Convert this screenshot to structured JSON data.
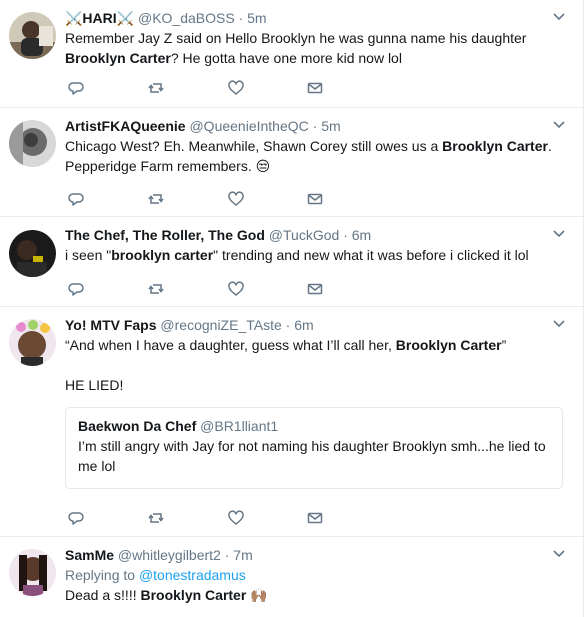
{
  "tweets": [
    {
      "name": "⚔️HARI⚔️",
      "handle": "@KO_daBOSS",
      "sep": "·",
      "time": "5m",
      "lines": [
        {
          "parts": [
            {
              "t": "Remember Jay Z said on Hello Brooklyn he was gunna name his daughter"
            }
          ]
        },
        {
          "parts": [
            {
              "t": "Brooklyn Carter",
              "b": true
            },
            {
              "t": "? He gotta have one more kid now lol"
            }
          ]
        }
      ]
    },
    {
      "name": "ArtistFKAQueenie",
      "handle": "@QueenieIntheQC",
      "sep": "·",
      "time": "5m",
      "lines": [
        {
          "parts": [
            {
              "t": "Chicago West? Eh. Meanwhile, Shawn Corey still owes us a "
            },
            {
              "t": "Brooklyn Carter",
              "b": true
            },
            {
              "t": "."
            }
          ]
        },
        {
          "parts": [
            {
              "t": "Pepperidge Farm remembers. "
            },
            {
              "t": "😒",
              "emoji": true
            }
          ]
        }
      ]
    },
    {
      "name": "The Chef, The Roller, The God",
      "handle": "@TuckGod",
      "sep": "·",
      "time": "6m",
      "lines": [
        {
          "parts": [
            {
              "t": "i seen \""
            },
            {
              "t": "brooklyn carter",
              "b": true
            },
            {
              "t": "\" trending and new what it was before i clicked it lol"
            }
          ]
        }
      ]
    },
    {
      "name": "Yo! MTV Faps",
      "handle": "@recogniZE_TAste",
      "sep": "·",
      "time": "6m",
      "lines": [
        {
          "parts": [
            {
              "t": "“And when I have a daughter, guess what I’ll call her, "
            },
            {
              "t": "Brooklyn Carter",
              "b": true
            },
            {
              "t": "”"
            }
          ]
        },
        {
          "parts": [
            {
              "t": " "
            }
          ]
        },
        {
          "parts": [
            {
              "t": "HE LIED!"
            }
          ]
        }
      ],
      "quote": {
        "name": "Baekwon Da Chef",
        "handle": "@BR1lliant1",
        "lines": [
          "I’m still angry with Jay for not naming his daughter Brooklyn smh...he lied to",
          "me lol"
        ]
      }
    },
    {
      "name": "SamMe",
      "handle": "@whitleygilbert2",
      "sep": "·",
      "time": "7m",
      "replying_label": "Replying to ",
      "replying_handle": "@tonestradamus",
      "lines": [
        {
          "parts": [
            {
              "t": "Dead a  ‌s!!!! "
            },
            {
              "t": "Brooklyn Carter",
              "b": true
            },
            {
              "t": " "
            },
            {
              "t": "🙌🏽",
              "emoji": true
            }
          ]
        }
      ]
    }
  ],
  "icons": {
    "reply": "reply-icon",
    "retweet": "retweet-icon",
    "like": "heart-icon",
    "message": "envelope-icon",
    "caret": "chevron-down-icon"
  },
  "colors": {
    "icon_gray": "#657786",
    "link_blue": "#1da1f2",
    "divider": "#e6ecf0"
  }
}
